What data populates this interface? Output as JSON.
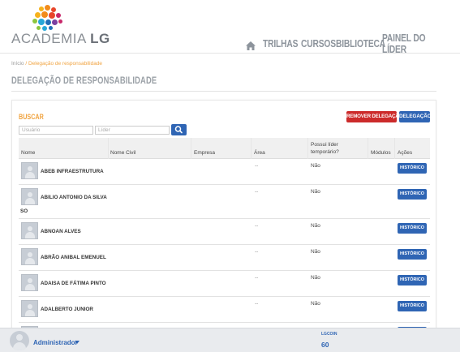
{
  "brand": {
    "name_prefix": "ACADEMIA",
    "name_suffix": "LG"
  },
  "nav": {
    "items": [
      {
        "label": "TRILHAS"
      },
      {
        "label": "CURSOS"
      },
      {
        "label": "BIBLIOTECA"
      },
      {
        "label": "PAINEL DO LÍDER"
      }
    ]
  },
  "breadcrumb": {
    "home": "Início",
    "separator": "/",
    "current": "Delegação de responsabilidade"
  },
  "page": {
    "title": "DELEGAÇÃO DE RESPONSABILIDADE"
  },
  "search": {
    "title": "BUSCAR",
    "usuario_placeholder": "Usuário",
    "lider_placeholder": "Líder"
  },
  "actions": {
    "remove_label": "REMOVER DELEGAÇÃO",
    "delegate_label": "DELEGAÇÃO"
  },
  "table": {
    "headers": {
      "nome": "Nome",
      "nome_civil": "Nome Civil",
      "empresa": "Empresa",
      "area": "Área",
      "lider_line1": "Possui líder",
      "lider_line2": "temporário?",
      "modulos": "Módulos",
      "acoes": "Ações"
    },
    "history_label": "HISTÓRICO",
    "rows": [
      {
        "name": "ABEB INFRAESTRUTURA",
        "area": "--",
        "lider": "Não"
      },
      {
        "name_line1": "ABILIO ANTONIO DA SILVA",
        "name_line2": "SO",
        "area": "--",
        "lider": "Não"
      },
      {
        "name": "ABNOAN ALVES",
        "area": "--",
        "lider": "Não"
      },
      {
        "name": "ABRÃO ANIBAL EMENUEL",
        "area": "--",
        "lider": "Não"
      },
      {
        "name": "ADAISA DE FÁTIMA PINTO",
        "area": "--",
        "lider": "Não"
      },
      {
        "name": "ADALBERTO JUNIOR",
        "area": "--",
        "lider": "Não"
      }
    ]
  },
  "footer": {
    "user": "Administrador",
    "coin_label": "LGCOIN",
    "coin_value": "60"
  },
  "colors": {
    "accent": "#f0a340",
    "primary": "#2f65b4",
    "danger": "#cc2b2b"
  }
}
